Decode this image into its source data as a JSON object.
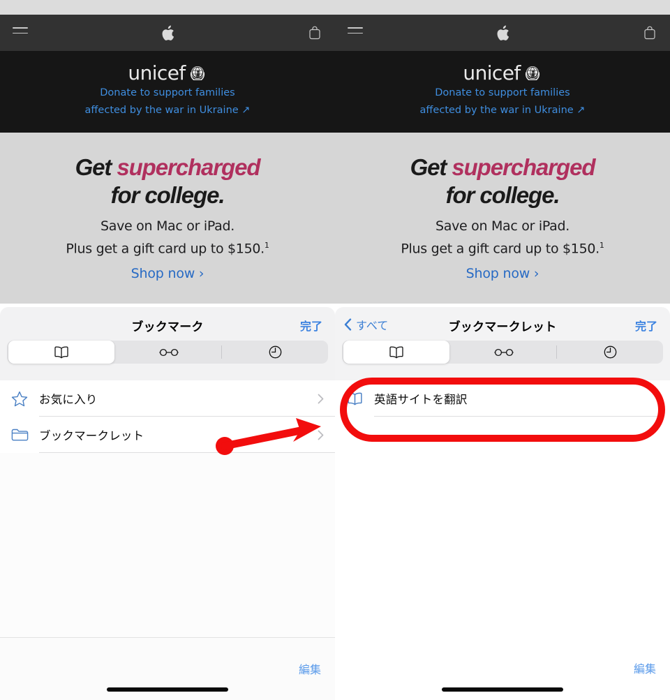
{
  "browser": {
    "nav": {
      "menu_icon": "hamburger-menu-icon",
      "brand_icon": "apple-logo-icon",
      "bag_icon": "shopping-bag-icon"
    },
    "banner": {
      "brand": "unicef",
      "emblem_icon": "un-emblem-icon",
      "line1": "Donate to support families",
      "line2": "affected by the war in Ukraine ↗"
    },
    "hero": {
      "headline_part1": "Get ",
      "headline_accent": "supercharged",
      "headline_line2": "for college.",
      "sub_line1": "Save on Mac or iPad.",
      "sub_line2": "Plus get a gift card up to $150.",
      "sub_footnote": "1",
      "cta": "Shop now ›"
    }
  },
  "panels": {
    "left": {
      "title": "ブックマーク",
      "done_label": "完了",
      "tabs": [
        {
          "name": "bookmarks",
          "icon": "book-icon",
          "selected": true
        },
        {
          "name": "reading-list",
          "icon": "glasses-icon",
          "selected": false
        },
        {
          "name": "history",
          "icon": "clock-icon",
          "selected": false
        }
      ],
      "rows": [
        {
          "label": "お気に入り",
          "icon": "star-icon",
          "chevron": "›"
        },
        {
          "label": "ブックマークレット",
          "icon": "folder-icon",
          "chevron": "›"
        }
      ],
      "edit_label": "編集"
    },
    "right": {
      "back_label": "すべて",
      "back_icon": "chevron-left-icon",
      "title": "ブックマークレット",
      "done_label": "完了",
      "tabs": [
        {
          "name": "bookmarks",
          "icon": "book-icon",
          "selected": true
        },
        {
          "name": "reading-list",
          "icon": "glasses-icon",
          "selected": false
        },
        {
          "name": "history",
          "icon": "clock-icon",
          "selected": false
        }
      ],
      "rows": [
        {
          "label": "英語サイトを翻訳",
          "icon": "book-outline-icon"
        }
      ],
      "edit_label": "編集"
    }
  },
  "annotations": {
    "arrow": {
      "color": "#f20d0d",
      "points_to": "ブックマークレット"
    },
    "oval": {
      "color": "#f20d0d",
      "highlights": "英語サイトを翻訳"
    }
  },
  "colors": {
    "nav_bar": "#323232",
    "banner_bg": "#161616",
    "hero_bg": "#d6d6d6",
    "accent_magenta": "#b0305e",
    "link_blue": "#276ac4",
    "ios_blue": "#3b82e0",
    "annotation_red": "#f20d0d"
  }
}
